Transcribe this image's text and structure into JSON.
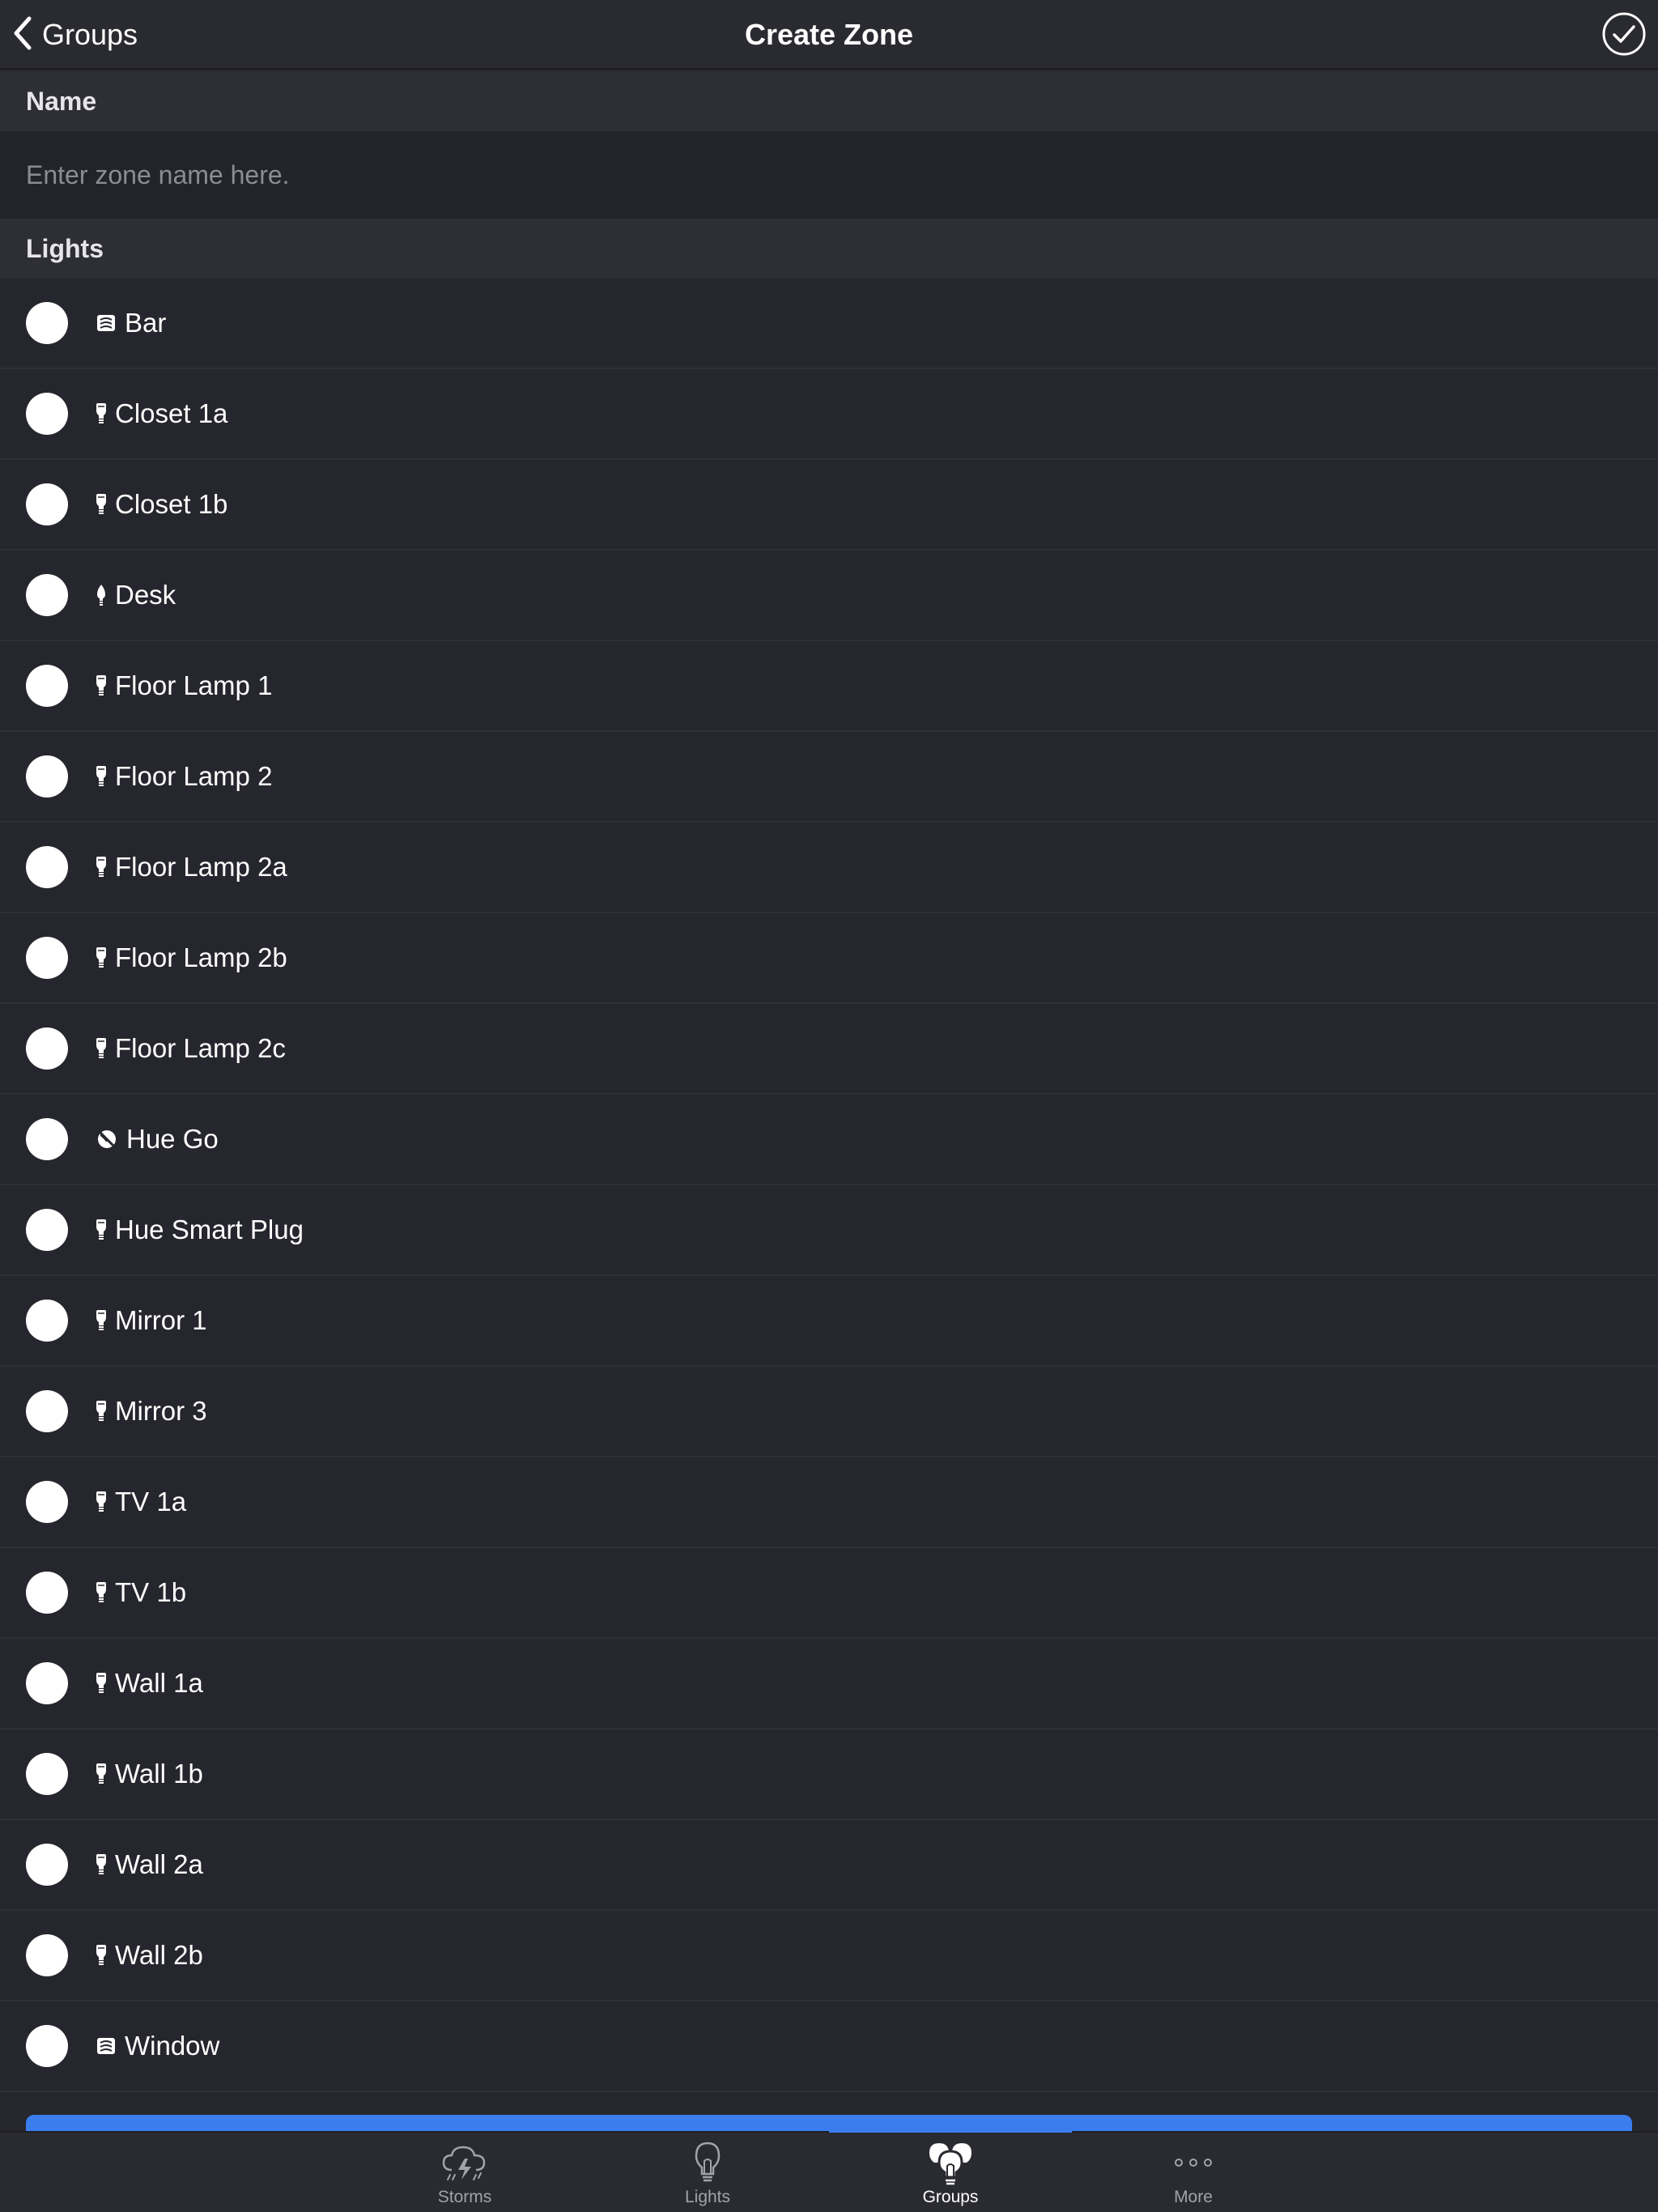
{
  "nav": {
    "back_label": "Groups",
    "title": "Create Zone"
  },
  "name_section": {
    "header": "Name",
    "placeholder": "Enter zone name here.",
    "value": ""
  },
  "lights_section": {
    "header": "Lights",
    "items": [
      {
        "label": "Bar",
        "icon": "lightstrip-icon",
        "selected": false
      },
      {
        "label": "Closet 1a",
        "icon": "spot-bulb-icon",
        "selected": false
      },
      {
        "label": "Closet 1b",
        "icon": "spot-bulb-icon",
        "selected": false
      },
      {
        "label": "Desk",
        "icon": "candle-bulb-icon",
        "selected": false
      },
      {
        "label": "Floor Lamp 1",
        "icon": "spot-bulb-icon",
        "selected": false
      },
      {
        "label": "Floor Lamp 2",
        "icon": "spot-bulb-icon",
        "selected": false
      },
      {
        "label": "Floor Lamp 2a",
        "icon": "spot-bulb-icon",
        "selected": false
      },
      {
        "label": "Floor Lamp 2b",
        "icon": "spot-bulb-icon",
        "selected": false
      },
      {
        "label": "Floor Lamp 2c",
        "icon": "spot-bulb-icon",
        "selected": false
      },
      {
        "label": "Hue Go",
        "icon": "hue-go-icon",
        "selected": false
      },
      {
        "label": "Hue Smart Plug",
        "icon": "spot-bulb-icon",
        "selected": false
      },
      {
        "label": "Mirror 1",
        "icon": "spot-bulb-icon",
        "selected": false
      },
      {
        "label": "Mirror 3",
        "icon": "spot-bulb-icon",
        "selected": false
      },
      {
        "label": "TV 1a",
        "icon": "spot-bulb-icon",
        "selected": false
      },
      {
        "label": "TV 1b",
        "icon": "spot-bulb-icon",
        "selected": false
      },
      {
        "label": "Wall 1a",
        "icon": "spot-bulb-icon",
        "selected": false
      },
      {
        "label": "Wall 1b",
        "icon": "spot-bulb-icon",
        "selected": false
      },
      {
        "label": "Wall 2a",
        "icon": "spot-bulb-icon",
        "selected": false
      },
      {
        "label": "Wall 2b",
        "icon": "spot-bulb-icon",
        "selected": false
      },
      {
        "label": "Window",
        "icon": "lightstrip-icon",
        "selected": false
      }
    ]
  },
  "tabbar": {
    "tabs": [
      {
        "label": "Storms",
        "icon": "storm-cloud-icon",
        "active": false
      },
      {
        "label": "Lights",
        "icon": "lightbulb-icon",
        "active": false
      },
      {
        "label": "Groups",
        "icon": "bulb-group-icon",
        "active": true
      },
      {
        "label": "More",
        "icon": "more-dots-icon",
        "active": false
      }
    ]
  },
  "colors": {
    "background": "#26262e",
    "navbar": "#2a2a31",
    "section_header": "#2e2e36",
    "accent": "#3b7ded",
    "text": "#ffffff",
    "placeholder": "#8c8c94"
  }
}
